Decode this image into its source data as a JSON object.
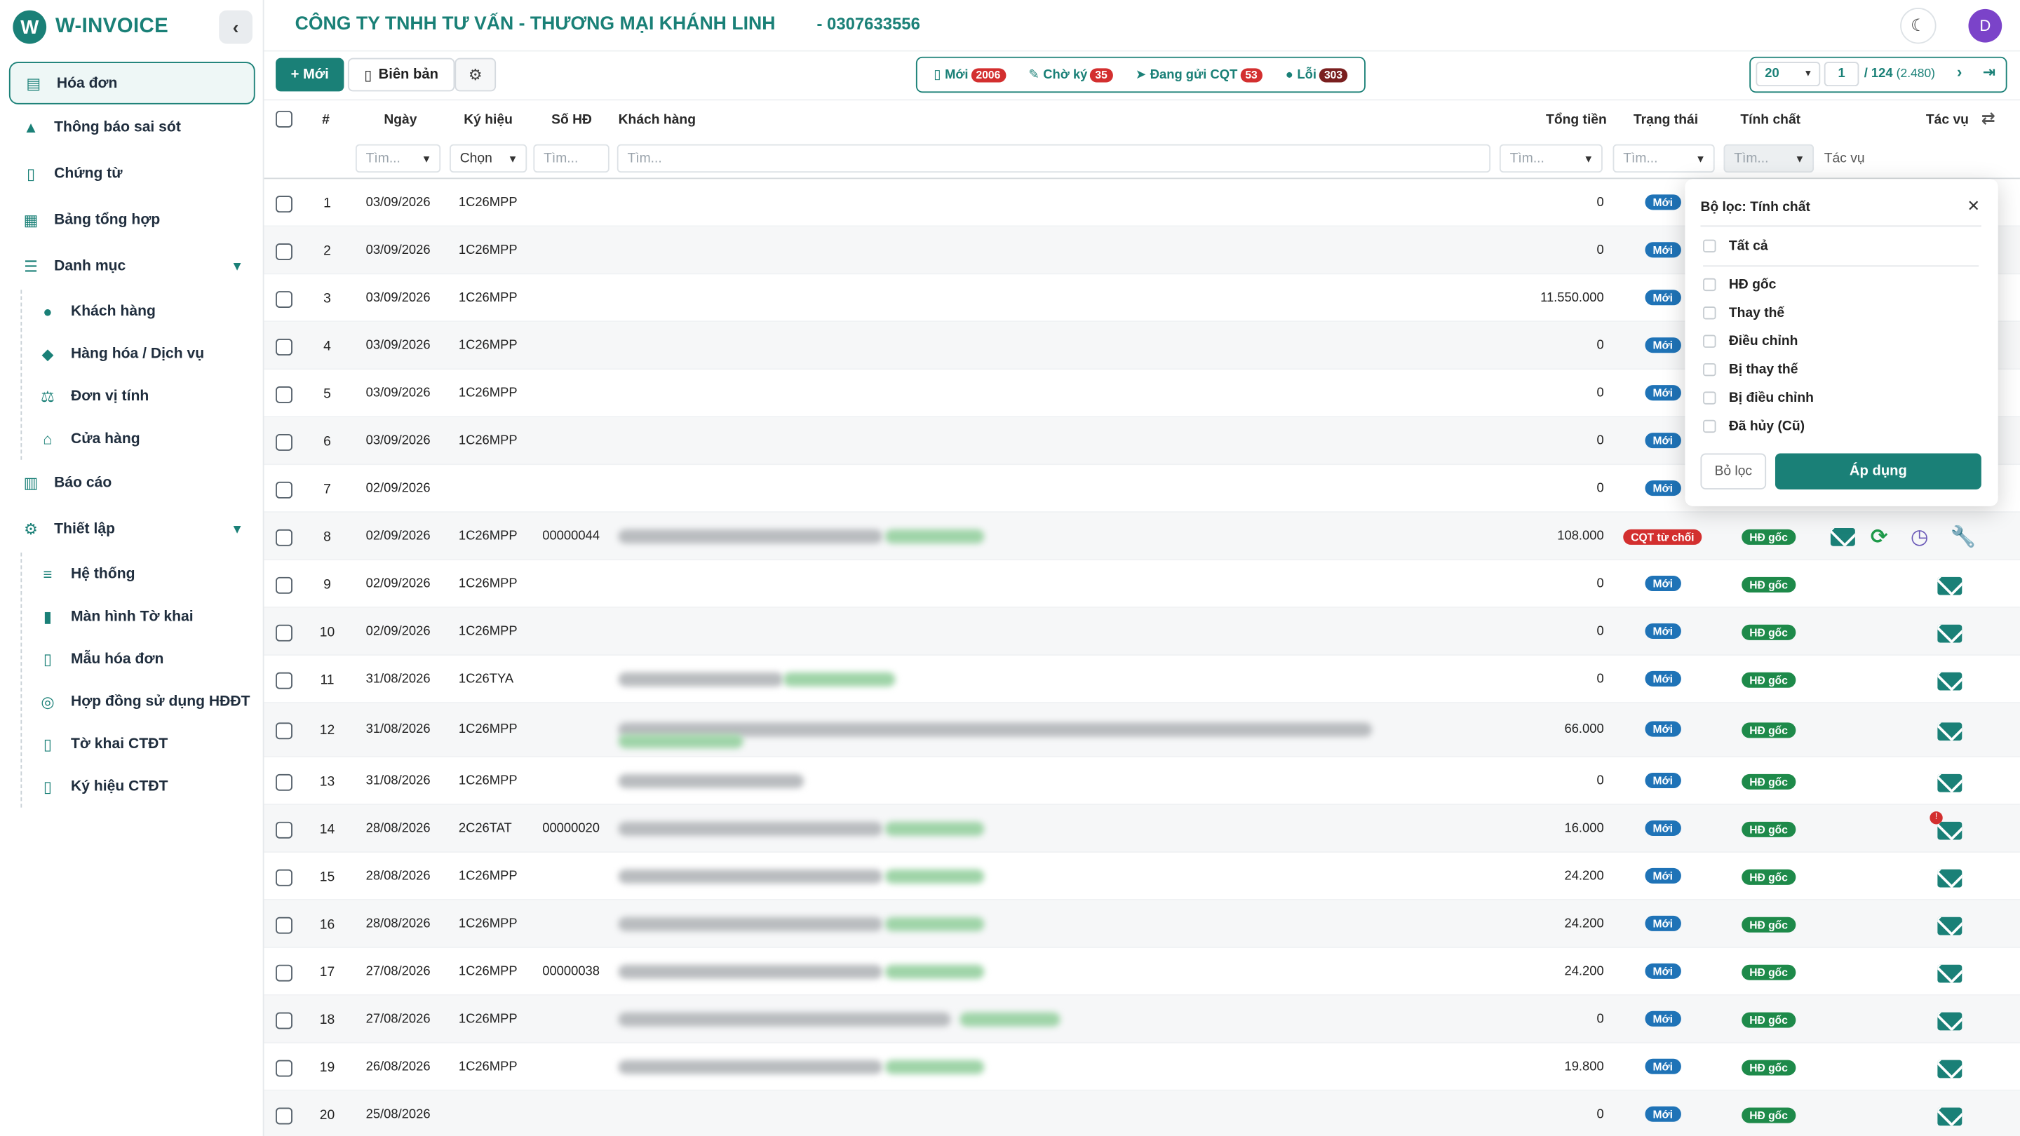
{
  "brand": {
    "name": "W-INVOICE"
  },
  "sidebar": {
    "items": [
      {
        "label": "Hóa đơn",
        "icon": "document-icon"
      },
      {
        "label": "Thông báo sai sót",
        "icon": "warning-icon"
      },
      {
        "label": "Chứng từ",
        "icon": "file-icon"
      },
      {
        "label": "Bảng tổng hợp",
        "icon": "table-icon"
      },
      {
        "label": "Danh mục",
        "icon": "list-icon"
      },
      {
        "label": "Báo cáo",
        "icon": "bar-chart-icon"
      },
      {
        "label": "Thiết lập",
        "icon": "gears-icon"
      }
    ],
    "danh_muc_sub": [
      {
        "label": "Khách hàng",
        "icon": "users-icon"
      },
      {
        "label": "Hàng hóa / Dịch vụ",
        "icon": "boxes-icon"
      },
      {
        "label": "Đơn vị tính",
        "icon": "scale-icon"
      },
      {
        "label": "Cửa hàng",
        "icon": "store-icon"
      }
    ],
    "thiet_lap_sub": [
      {
        "label": "Hệ thống",
        "icon": "sliders-icon"
      },
      {
        "label": "Màn hình Tờ khai",
        "icon": "form-icon"
      },
      {
        "label": "Mẫu hóa đơn",
        "icon": "template-icon"
      },
      {
        "label": "Hợp đồng sử dụng HĐĐT",
        "icon": "handshake-icon"
      },
      {
        "label": "Tờ khai CTĐT",
        "icon": "file-icon"
      },
      {
        "label": "Ký hiệu CTĐT",
        "icon": "file-icon"
      }
    ]
  },
  "header": {
    "company": "CÔNG TY TNHH TƯ VẤN - THƯƠNG MẠI KHÁNH LINH",
    "tax_code": "- 0307633556",
    "avatar_letter": "D"
  },
  "toolbar": {
    "new_label": "Mới",
    "minutes_label": "Biên bản",
    "status_tabs": [
      {
        "label": "Mới",
        "count": "2006"
      },
      {
        "label": "Chờ ký",
        "count": "35"
      },
      {
        "label": "Đang gửi CQT",
        "count": "53"
      },
      {
        "label": "Lỗi",
        "count": "303"
      }
    ]
  },
  "pager": {
    "page_size": "20",
    "current": "1",
    "total": "/ 124",
    "records": "(2.480)"
  },
  "columns": {
    "index": "#",
    "date": "Ngày",
    "symbol": "Ký hiệu",
    "number": "Số HĐ",
    "customer": "Khách hàng",
    "total": "Tổng tiền",
    "status": "Trạng thái",
    "nature": "Tính chất",
    "actions": "Tác vụ"
  },
  "filters": {
    "search_placeholder": "Tìm...",
    "choose": "Chọn",
    "actions_label": "Tác vụ"
  },
  "rows": [
    {
      "idx": "1",
      "date": "03/09/2026",
      "symbol": "1C26MPP",
      "number": "",
      "total": "0",
      "status": "Mới",
      "nature": ""
    },
    {
      "idx": "2",
      "date": "03/09/2026",
      "symbol": "1C26MPP",
      "number": "",
      "total": "0",
      "status": "Mới",
      "nature": ""
    },
    {
      "idx": "3",
      "date": "03/09/2026",
      "symbol": "1C26MPP",
      "number": "",
      "total": "11.550.000",
      "status": "Mới",
      "nature": ""
    },
    {
      "idx": "4",
      "date": "03/09/2026",
      "symbol": "1C26MPP",
      "number": "",
      "total": "0",
      "status": "Mới",
      "nature": ""
    },
    {
      "idx": "5",
      "date": "03/09/2026",
      "symbol": "1C26MPP",
      "number": "",
      "total": "0",
      "status": "Mới",
      "nature": ""
    },
    {
      "idx": "6",
      "date": "03/09/2026",
      "symbol": "1C26MPP",
      "number": "",
      "total": "0",
      "status": "Mới",
      "nature": ""
    },
    {
      "idx": "7",
      "date": "02/09/2026",
      "symbol": "",
      "number": "",
      "total": "0",
      "status": "Mới",
      "nature": ""
    },
    {
      "idx": "8",
      "date": "02/09/2026",
      "symbol": "1C26MPP",
      "number": "00000044",
      "total": "108.000",
      "status": "CQT từ chối",
      "nature": "HĐ gốc"
    },
    {
      "idx": "9",
      "date": "02/09/2026",
      "symbol": "1C26MPP",
      "number": "",
      "total": "0",
      "status": "Mới",
      "nature": "HĐ gốc"
    },
    {
      "idx": "10",
      "date": "02/09/2026",
      "symbol": "1C26MPP",
      "number": "",
      "total": "0",
      "status": "Mới",
      "nature": "HĐ gốc"
    },
    {
      "idx": "11",
      "date": "31/08/2026",
      "symbol": "1C26TYA",
      "number": "",
      "total": "0",
      "status": "Mới",
      "nature": "HĐ gốc"
    },
    {
      "idx": "12",
      "date": "31/08/2026",
      "symbol": "1C26MPP",
      "number": "",
      "total": "66.000",
      "status": "Mới",
      "nature": "HĐ gốc"
    },
    {
      "idx": "13",
      "date": "31/08/2026",
      "symbol": "1C26MPP",
      "number": "",
      "total": "0",
      "status": "Mới",
      "nature": "HĐ gốc"
    },
    {
      "idx": "14",
      "date": "28/08/2026",
      "symbol": "2C26TAT",
      "number": "00000020",
      "total": "16.000",
      "status": "Mới",
      "nature": "HĐ gốc"
    },
    {
      "idx": "15",
      "date": "28/08/2026",
      "symbol": "1C26MPP",
      "number": "",
      "total": "24.200",
      "status": "Mới",
      "nature": "HĐ gốc"
    },
    {
      "idx": "16",
      "date": "28/08/2026",
      "symbol": "1C26MPP",
      "number": "",
      "total": "24.200",
      "status": "Mới",
      "nature": "HĐ gốc"
    },
    {
      "idx": "17",
      "date": "27/08/2026",
      "symbol": "1C26MPP",
      "number": "00000038",
      "total": "24.200",
      "status": "Mới",
      "nature": "HĐ gốc"
    },
    {
      "idx": "18",
      "date": "27/08/2026",
      "symbol": "1C26MPP",
      "number": "",
      "total": "0",
      "status": "Mới",
      "nature": "HĐ gốc"
    },
    {
      "idx": "19",
      "date": "26/08/2026",
      "symbol": "1C26MPP",
      "number": "",
      "total": "19.800",
      "status": "Mới",
      "nature": "HĐ gốc"
    },
    {
      "idx": "20",
      "date": "25/08/2026",
      "symbol": "",
      "number": "",
      "total": "0",
      "status": "Mới",
      "nature": "HĐ gốc"
    }
  ],
  "popover": {
    "title": "Bộ lọc: Tính chất",
    "all": "Tất cả",
    "options": [
      "HĐ gốc",
      "Thay thế",
      "Điều chỉnh",
      "Bị thay thế",
      "Bị điều chỉnh",
      "Đã hủy (Cũ)"
    ],
    "clear": "Bỏ lọc",
    "apply": "Áp dụng"
  },
  "colors": {
    "brand": "#1a8077",
    "status_new": "#1f73b7",
    "nature_goc": "#1e8a4a",
    "danger": "#d32f2f"
  }
}
